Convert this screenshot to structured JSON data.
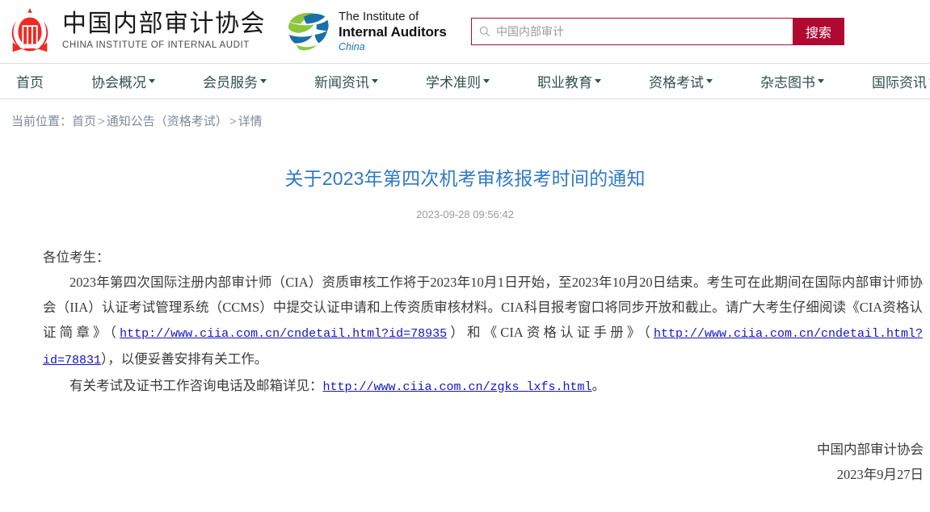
{
  "header": {
    "ciia_logo": {
      "icon": "ciia-emblem-icon",
      "cn_name": "中国内部审计协会",
      "en_name": "CHINA INSTITUTE OF INTERNAL AUDIT"
    },
    "iia_logo": {
      "icon": "iia-globe-icon",
      "line1": "The Institute of",
      "line2": "Internal Auditors",
      "line3": "China"
    },
    "search": {
      "icon": "search-icon",
      "placeholder": "中国内部审计",
      "value": "",
      "button_label": "搜索"
    }
  },
  "nav": {
    "items": [
      {
        "label": "首页",
        "has_dropdown": false
      },
      {
        "label": "协会概况",
        "has_dropdown": true
      },
      {
        "label": "会员服务",
        "has_dropdown": true
      },
      {
        "label": "新闻资讯",
        "has_dropdown": true
      },
      {
        "label": "学术准则",
        "has_dropdown": true
      },
      {
        "label": "职业教育",
        "has_dropdown": true
      },
      {
        "label": "资格考试",
        "has_dropdown": true
      },
      {
        "label": "杂志图书",
        "has_dropdown": true
      },
      {
        "label": "国际资讯",
        "has_dropdown": true
      }
    ]
  },
  "breadcrumb": {
    "prefix": "当前位置：",
    "items": [
      "首页",
      "通知公告（资格考试）",
      "详情"
    ],
    "separator": ">"
  },
  "article": {
    "title": "关于2023年第四次机考审核报考时间的通知",
    "date": "2023-09-28 09:56:42",
    "salutation": "各位考生：",
    "para1_part1": "2023年第四次国际注册内部审计师（CIA）资质审核工作将于2023年10月1日开始，至2023年10月20日结束。考生可在此期间在国际内部审计师协会（IIA）认证考试管理系统（CCMS）中提交认证申请和上传资质审核材料。CIA科目报考窗口将同步开放和截止。请广大考生仔细阅读《CIA资格认证简章》（",
    "link1": "http://www.ciia.com.cn/cndetail.html?id=78935",
    "para1_part2": "）和《CIA资格认证手册》（",
    "link2": "http://www.ciia.com.cn/cndetail.html?id=78831",
    "para1_part3": "），以便妥善安排有关工作。",
    "para2_prefix": "有关考试及证书工作咨询电话及邮箱详见：",
    "link3": "http://www.ciia.com.cn/zgks_lxfs.html",
    "para2_suffix": "。",
    "signature_org": "中国内部审计协会",
    "signature_date": "2023年9月27日"
  },
  "colors": {
    "brand_red": "#b00a32",
    "logo_red": "#ee2a23",
    "nav_text": "#31504d",
    "title_blue": "#2f79c9",
    "link_blue": "#1414c8",
    "iia_green": "#8cc63e",
    "iia_blue": "#1b6fa8"
  }
}
